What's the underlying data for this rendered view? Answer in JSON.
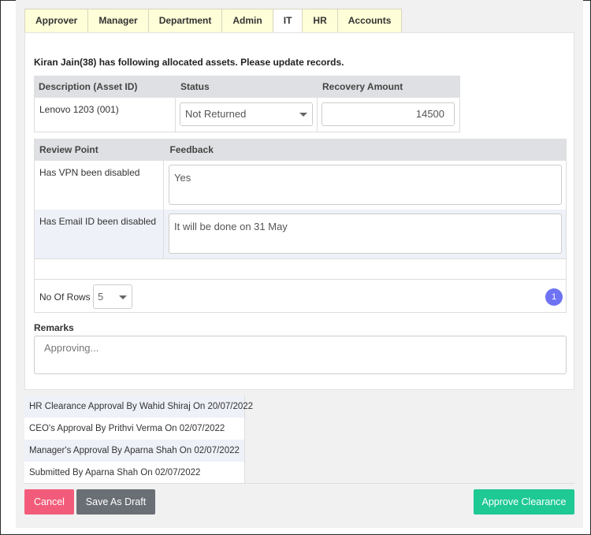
{
  "tabs": [
    {
      "label": "Approver"
    },
    {
      "label": "Manager"
    },
    {
      "label": "Department"
    },
    {
      "label": "Admin"
    },
    {
      "label": "IT",
      "active": true
    },
    {
      "label": "HR"
    },
    {
      "label": "Accounts"
    }
  ],
  "intro": "Kiran Jain(38) has following allocated assets. Please update records.",
  "assets": {
    "headers": [
      "Description (Asset ID)",
      "Status",
      "Recovery Amount"
    ],
    "rows": [
      {
        "description": "Lenovo 1203 (001)",
        "status": "Not Returned",
        "recovery_amount": "14500"
      }
    ]
  },
  "review": {
    "headers": [
      "Review Point",
      "Feedback"
    ],
    "rows": [
      {
        "point": "Has VPN been disabled",
        "feedback": "Yes"
      },
      {
        "point": "Has Email ID been disabled",
        "feedback": "It will be done on 31 May"
      }
    ],
    "rows_label": "No Of Rows :",
    "rows_value": "5",
    "current_page": "1"
  },
  "remarks": {
    "label": "Remarks",
    "value": "Approving..."
  },
  "history": [
    "HR Clearance Approval By Wahid Shiraj On 20/07/2022",
    "CEO's Approval By Prithvi Verma On 02/07/2022",
    "Manager's Approval By Aparna Shah On 02/07/2022",
    "Submitted By Aparna Shah On 02/07/2022"
  ],
  "buttons": {
    "cancel": "Cancel",
    "save_draft": "Save As Draft",
    "approve": "Approve Clearance"
  },
  "colors": {
    "tab_bg": "#fefed8",
    "page_btn": "#6e73f3",
    "cancel": "#f25c7a",
    "draft": "#6a6f75",
    "approve": "#1ec994"
  }
}
